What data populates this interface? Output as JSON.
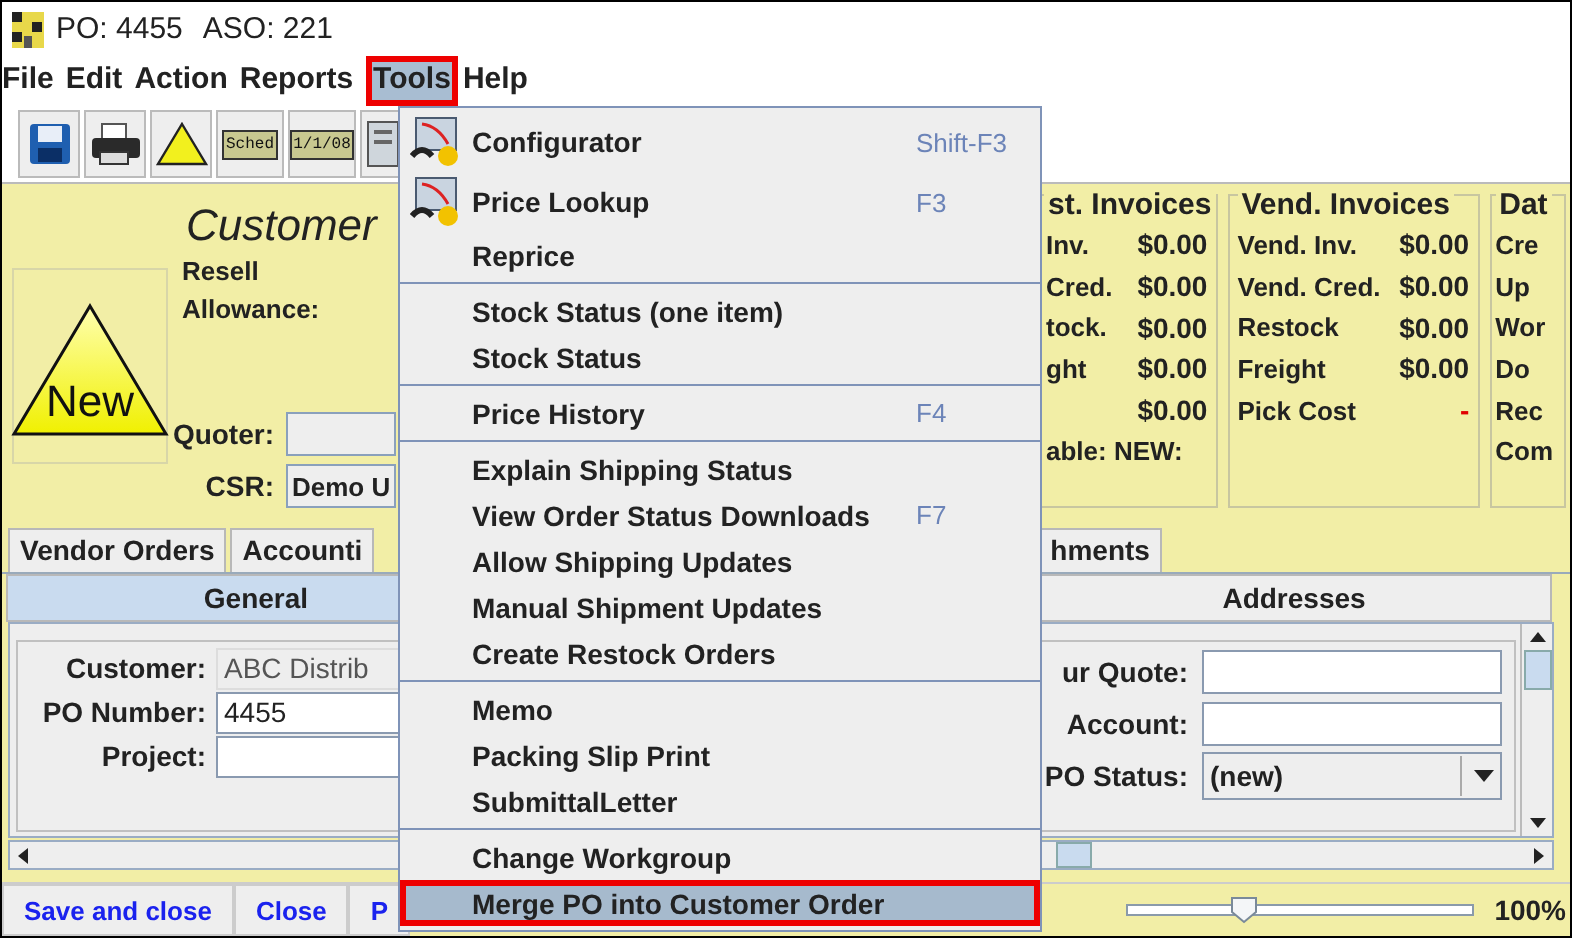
{
  "window": {
    "title_parts": [
      "PO: 4455",
      "ASO: 221"
    ]
  },
  "menubar": [
    {
      "label": "File",
      "selected": false,
      "callout": false
    },
    {
      "label": "Edit",
      "selected": false,
      "callout": false
    },
    {
      "label": "Action",
      "selected": false,
      "callout": false
    },
    {
      "label": "Reports",
      "selected": false,
      "callout": false
    },
    {
      "label": "Tools",
      "selected": true,
      "callout": true
    },
    {
      "label": "Help",
      "selected": false,
      "callout": false
    }
  ],
  "toolbar": [
    {
      "kind": "save"
    },
    {
      "kind": "print"
    },
    {
      "kind": "warning"
    },
    {
      "kind": "text",
      "label": "Sched"
    },
    {
      "kind": "text",
      "label": "1/1/08"
    },
    {
      "kind": "document"
    }
  ],
  "header": {
    "title": "Customer",
    "badge": "New",
    "labels": [
      "Resell",
      "Allowance:"
    ],
    "fields": [
      {
        "label": "Quoter:"
      },
      {
        "label": "CSR:",
        "value": "Demo U"
      }
    ]
  },
  "panels": [
    {
      "title": "st. Invoices",
      "rows": [
        {
          "label": "Inv.",
          "value": "$0.00"
        },
        {
          "label": "Cred.",
          "value": "$0.00"
        },
        {
          "label": "tock.",
          "value": "$0.00"
        },
        {
          "label": "ght",
          "value": "$0.00"
        },
        {
          "value": "$0.00"
        },
        {
          "label": "able: NEW:"
        }
      ]
    },
    {
      "title": "Vend. Invoices",
      "rows": [
        {
          "label": "Vend. Inv.",
          "value": "$0.00"
        },
        {
          "label": "Vend. Cred.",
          "value": "$0.00"
        },
        {
          "label": "Restock",
          "value": "$0.00"
        },
        {
          "label": "Freight",
          "value": "$0.00"
        },
        {
          "label": "Pick Cost",
          "value": "-",
          "color": "#e00000"
        }
      ]
    },
    {
      "title": "Dat",
      "rows": [
        {
          "label": "Cre"
        },
        {
          "label": "Up"
        },
        {
          "label": "Wor"
        },
        {
          "label": "Do"
        },
        {
          "label": "Rec"
        },
        {
          "label": "Com"
        }
      ]
    }
  ],
  "tabs": [
    {
      "label": "Vendor Orders",
      "selected": false
    },
    {
      "label": "Accounti",
      "selected": false
    },
    {
      "label": "hments",
      "selected": false
    }
  ],
  "subtabs": [
    {
      "label": "General",
      "selected": true
    },
    {
      "label": "Addresses",
      "selected": false
    }
  ],
  "form": {
    "left": [
      {
        "label": "Customer:",
        "value": "ABC Distrib",
        "disabled": true
      },
      {
        "label": "PO Number:",
        "value": "4455",
        "disabled": false
      },
      {
        "label": "Project:",
        "disabled": false
      }
    ],
    "right": [
      {
        "label": "ur Quote:",
        "kind": "text"
      },
      {
        "label": "Account:",
        "kind": "text"
      },
      {
        "label": "PO Status:",
        "kind": "select",
        "value": "(new)"
      }
    ]
  },
  "footer": {
    "buttons": [
      "Save and close",
      "Close",
      "P"
    ],
    "zoom": {
      "level": 0.34,
      "reading": "100%"
    }
  },
  "tools_menu": {
    "items": [
      {
        "kind": "item",
        "label": "Configurator",
        "shortcut": "Shift-F3",
        "icon": true,
        "selected": false,
        "callout": false
      },
      {
        "kind": "item",
        "label": "Price Lookup",
        "shortcut": "F3",
        "icon": true,
        "selected": false,
        "callout": false
      },
      {
        "kind": "item",
        "label": "Reprice",
        "icon": false,
        "selected": false,
        "callout": false
      },
      {
        "kind": "separator"
      },
      {
        "kind": "item",
        "label": "Stock Status (one item)",
        "icon": false,
        "selected": false,
        "callout": false
      },
      {
        "kind": "item",
        "label": "Stock Status",
        "icon": false,
        "selected": false,
        "callout": false
      },
      {
        "kind": "separator"
      },
      {
        "kind": "item",
        "label": "Price History",
        "shortcut": "F4",
        "icon": false,
        "selected": false,
        "callout": false
      },
      {
        "kind": "separator"
      },
      {
        "kind": "item",
        "label": "Explain Shipping Status",
        "icon": false,
        "selected": false,
        "callout": false
      },
      {
        "kind": "item",
        "label": "View Order Status Downloads",
        "shortcut": "F7",
        "icon": false,
        "selected": false,
        "callout": false
      },
      {
        "kind": "item",
        "label": "Allow Shipping Updates",
        "icon": false,
        "selected": false,
        "callout": false
      },
      {
        "kind": "item",
        "label": "Manual Shipment Updates",
        "icon": false,
        "selected": false,
        "callout": false
      },
      {
        "kind": "item",
        "label": "Create Restock Orders",
        "icon": false,
        "selected": false,
        "callout": false
      },
      {
        "kind": "separator"
      },
      {
        "kind": "item",
        "label": "Memo",
        "icon": false,
        "selected": false,
        "callout": false
      },
      {
        "kind": "item",
        "label": "Packing Slip Print",
        "icon": false,
        "selected": false,
        "callout": false
      },
      {
        "kind": "item",
        "label": "SubmittalLetter",
        "icon": false,
        "selected": false,
        "callout": false
      },
      {
        "kind": "separator"
      },
      {
        "kind": "item",
        "label": "Change Workgroup",
        "icon": false,
        "selected": false,
        "callout": false
      },
      {
        "kind": "item",
        "label": "Merge PO into Customer Order",
        "icon": false,
        "selected": true,
        "callout": true
      }
    ]
  }
}
